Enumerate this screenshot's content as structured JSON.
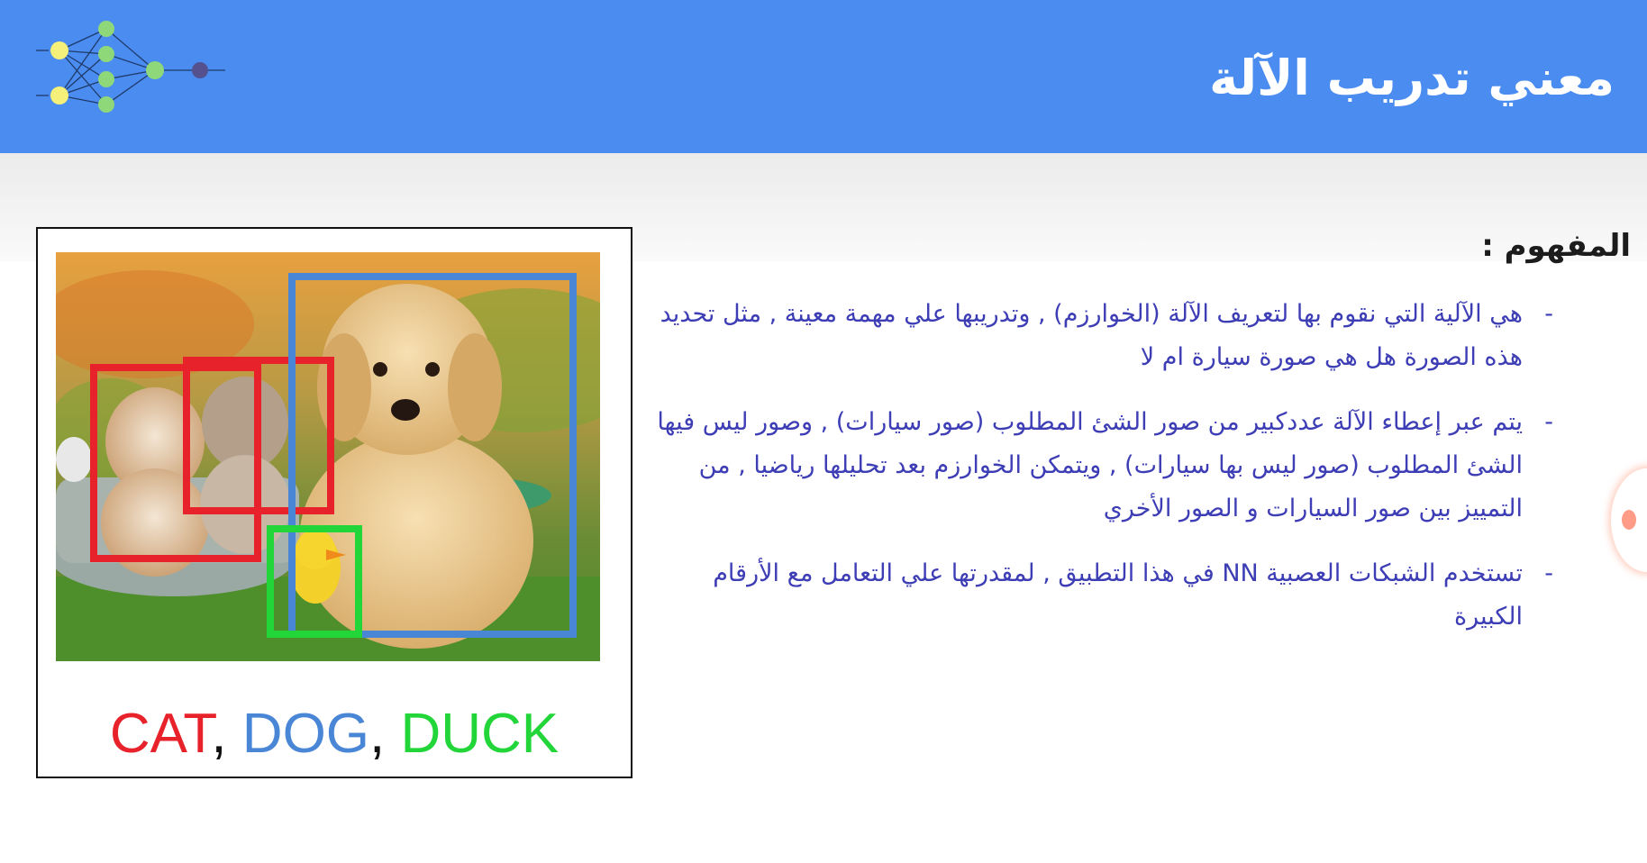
{
  "slide": {
    "title": "معني تدريب الآلة",
    "concept_heading": "المفهوم :",
    "bullets": [
      "هي الآلية التي نقوم بها لتعريف الآلة (الخوارزم) , وتدريبها علي مهمة معينة , مثل تحديد هذه الصورة هل هي صورة سيارة ام لا",
      "يتم عبر إعطاء الآلة عددكبير من صور الشئ المطلوب (صور سيارات) , وصور ليس فيها الشئ المطلوب (صور ليس بها سيارات) , ويتمكن الخوارزم بعد تحليلها رياضيا , من التمييز بين صور السيارات و الصور الأخري",
      "تستخدم الشبكات العصبية NN في هذا التطبيق , لمقدرتها علي التعامل مع الأرقام الكبيرة"
    ],
    "bullet_marker": "-"
  },
  "figure": {
    "caption": {
      "cat": "CAT",
      "sep1": ", ",
      "dog": "DOG",
      "sep2": ", ",
      "duck": "DUCK"
    }
  },
  "colors": {
    "header": "#4a8cef",
    "bullet_text": "#3d3db5",
    "cat_box": "#e8222a",
    "dog_box": "#4a86d6",
    "duck_box": "#22d63a"
  }
}
